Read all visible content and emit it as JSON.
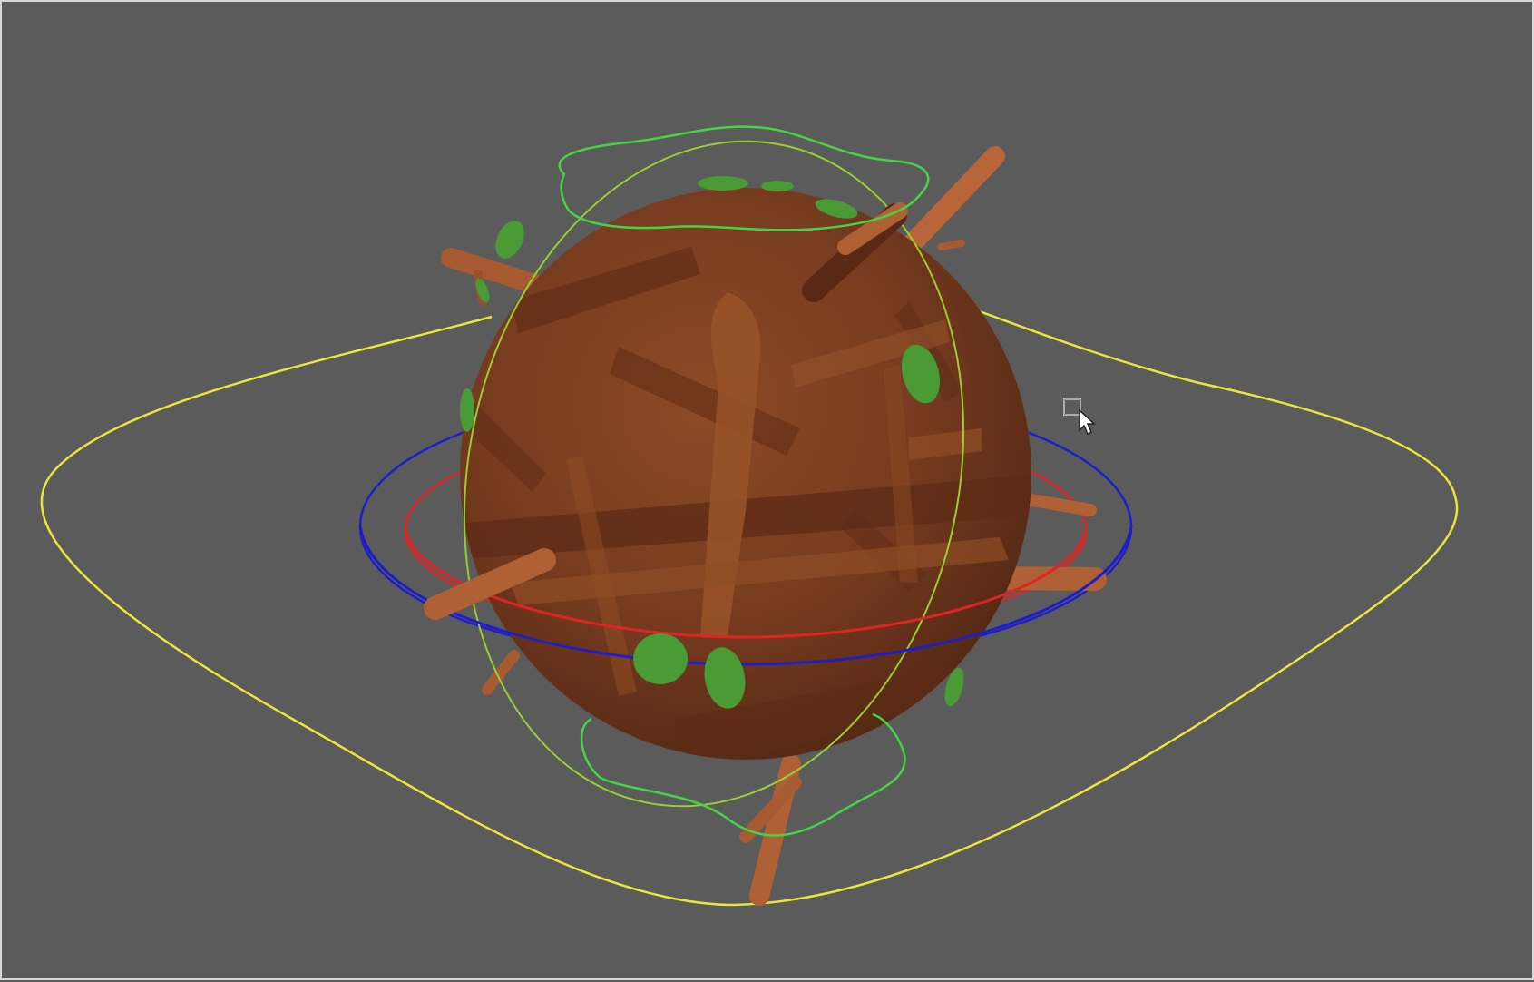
{
  "viewport": {
    "background_color": "#5b5b5b",
    "border_color": "#d9d9d9"
  },
  "scene": {
    "object": "textured-sphere",
    "colors": {
      "sphere_base": "#7a3c20",
      "sphere_dark": "#5a2814",
      "sphere_light": "#9a5428",
      "branch": "#b06035",
      "leaf": "#4a9a35",
      "yellow_control": "#e6e63c",
      "green_control": "#44d444",
      "red_ring": "#e02424",
      "blue_ring": "#1e1ec8",
      "lime_ring": "#9acd32"
    },
    "controls": [
      "yellow-main-control",
      "green-top-control",
      "green-bottom-control",
      "red-ring",
      "blue-ring",
      "lime-vertical-ring"
    ]
  },
  "cursor": {
    "icon": "select-box-arrow-cursor"
  }
}
